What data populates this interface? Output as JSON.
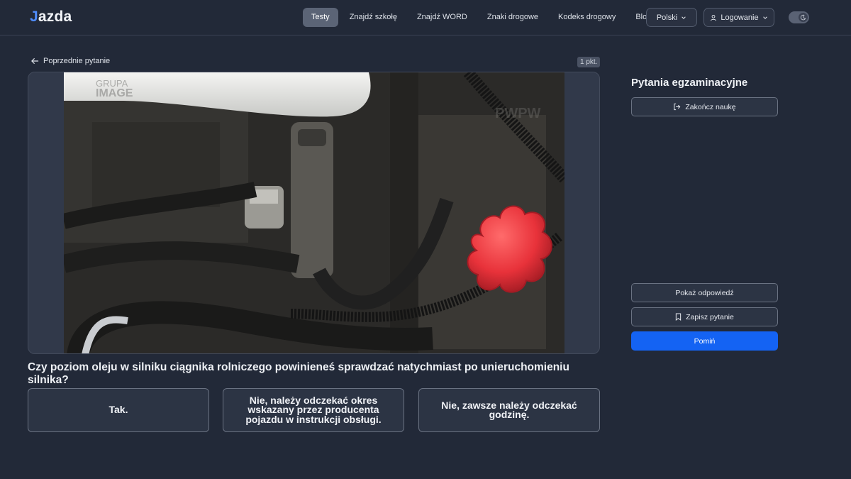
{
  "header": {
    "logo_letter": "J",
    "logo_rest": "azda",
    "nav": [
      "Testy",
      "Znajdź szkołę",
      "Znajdź WORD",
      "Znaki drogowe",
      "Kodeks drogowy",
      "Blog"
    ],
    "active_nav": "Testy",
    "language": "Polski",
    "login": "Logowanie",
    "theme_toggle": "dark-mode-toggle"
  },
  "question": {
    "back_label": "Poprzednie pytanie",
    "points": "1 pkt.",
    "text": "Czy poziom oleju w silniku ciągnika rolniczego powinieneś sprawdzać natychmiast po unieruchomieniu silnika?",
    "image_watermark_1": "GRUPA",
    "image_watermark_2": "IMAGE",
    "image_watermark_3": "PWPW",
    "answers": [
      "Tak.",
      "Nie, należy odczekać okres wskazany przez producenta pojazdu w instrukcji obsługi.",
      "Nie, zawsze należy odczekać godzinę."
    ]
  },
  "sidebar": {
    "title": "Pytania egzaminacyjne",
    "finish_label": "Zakończ naukę",
    "show_answer_label": "Pokaż odpowiedź",
    "save_label": "Zapisz pytanie",
    "skip_label": "Pomiń"
  },
  "colors": {
    "background": "#222938",
    "primary": "#1463f3",
    "oil_cap": "#e8323a"
  }
}
